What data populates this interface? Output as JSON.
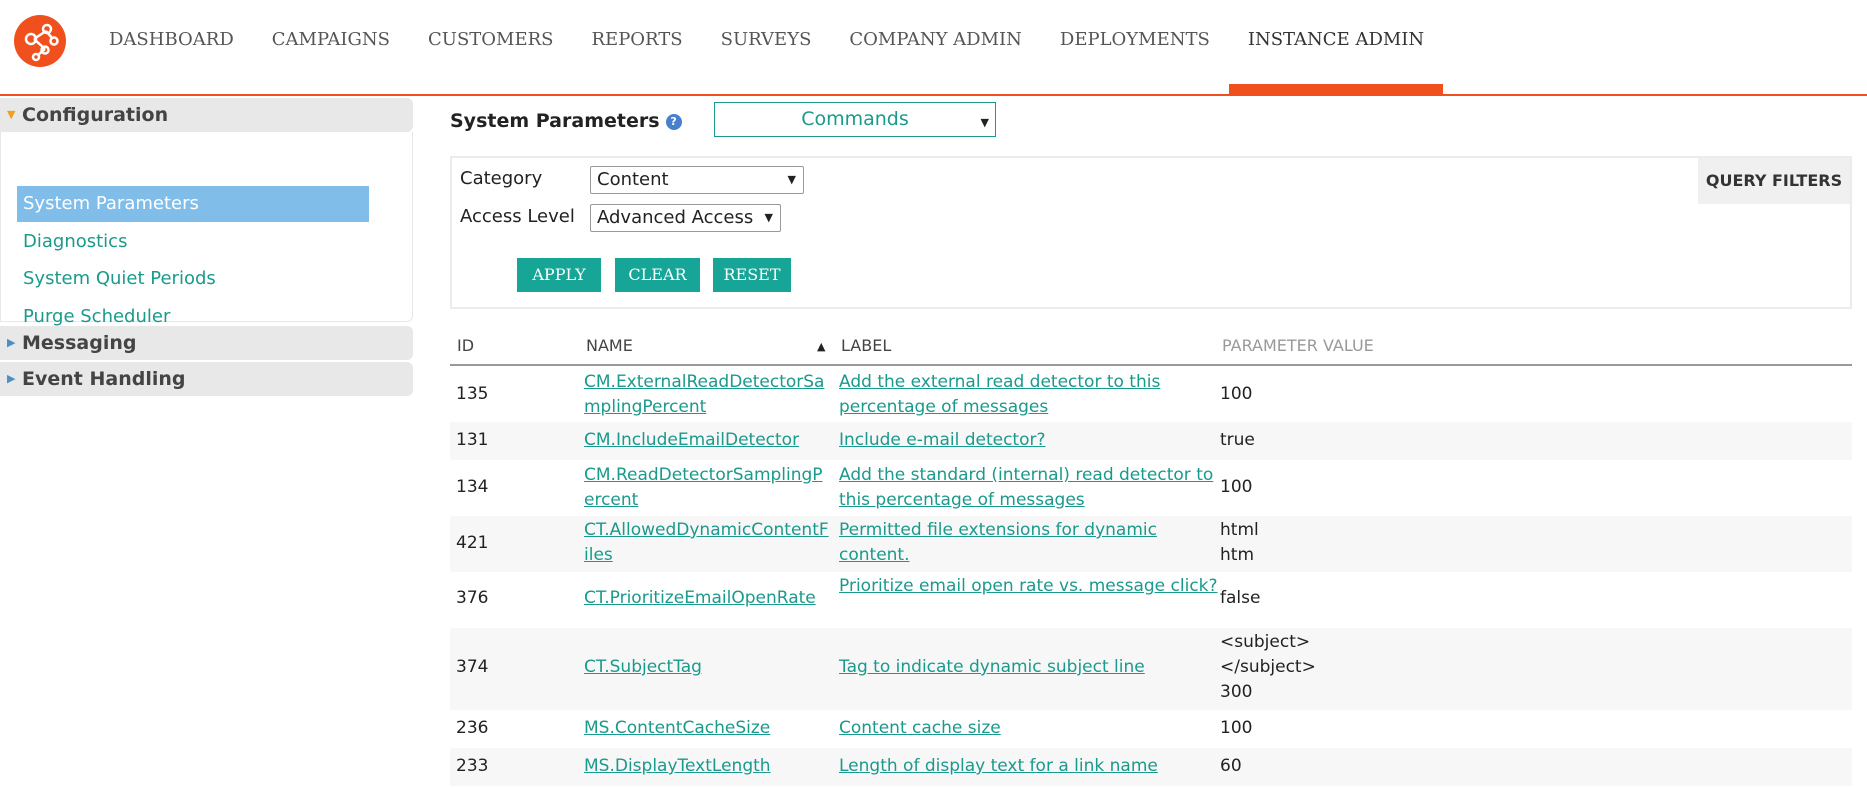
{
  "nav": {
    "items": [
      "DASHBOARD",
      "CAMPAIGNS",
      "CUSTOMERS",
      "REPORTS",
      "SURVEYS",
      "COMPANY ADMIN",
      "DEPLOYMENTS",
      "INSTANCE ADMIN"
    ],
    "active": "INSTANCE ADMIN"
  },
  "sidebar": {
    "configuration": {
      "title": "Configuration",
      "items": [
        "System Parameters",
        "Diagnostics",
        "System Quiet Periods",
        "Purge Scheduler"
      ],
      "selected": "System Parameters"
    },
    "messaging": {
      "title": "Messaging"
    },
    "event_handling": {
      "title": "Event Handling"
    }
  },
  "page": {
    "title": "System Parameters",
    "help_icon": "?",
    "commands_label": "Commands"
  },
  "filters": {
    "category_label": "Category",
    "category_value": "Content",
    "access_label": "Access Level",
    "access_value": "Advanced Access",
    "apply": "APPLY",
    "clear": "CLEAR",
    "reset": "RESET",
    "query_filters": "QUERY FILTERS"
  },
  "table": {
    "headers": {
      "id": "ID",
      "name": "NAME",
      "label": "LABEL",
      "value": "PARAMETER VALUE"
    },
    "rows": [
      {
        "id": "135",
        "name": "CM.ExternalReadDetectorSamplingPercent",
        "label": "Add the external read detector to this percentage of messages",
        "value": "100"
      },
      {
        "id": "131",
        "name": "CM.IncludeEmailDetector",
        "label": "Include e-mail detector?",
        "value": "true"
      },
      {
        "id": "134",
        "name": "CM.ReadDetectorSamplingPercent",
        "label": "Add the standard (internal) read detector to this percentage of messages",
        "value": "100"
      },
      {
        "id": "421",
        "name": "CT.AllowedDynamicContentFiles",
        "label": "Permitted file extensions for dynamic content.",
        "value": "html\nhtm"
      },
      {
        "id": "376",
        "name": "CT.PrioritizeEmailOpenRate",
        "label": "Prioritize email open rate vs. message click?",
        "value": "false"
      },
      {
        "id": "374",
        "name": "CT.SubjectTag",
        "label": "Tag to indicate dynamic subject line",
        "value": "<subject>\n</subject>\n300"
      },
      {
        "id": "236",
        "name": "MS.ContentCacheSize",
        "label": "Content cache size",
        "value": "100"
      },
      {
        "id": "233",
        "name": "MS.DisplayTextLength",
        "label": "Length of display text for a link name",
        "value": "60"
      }
    ]
  }
}
